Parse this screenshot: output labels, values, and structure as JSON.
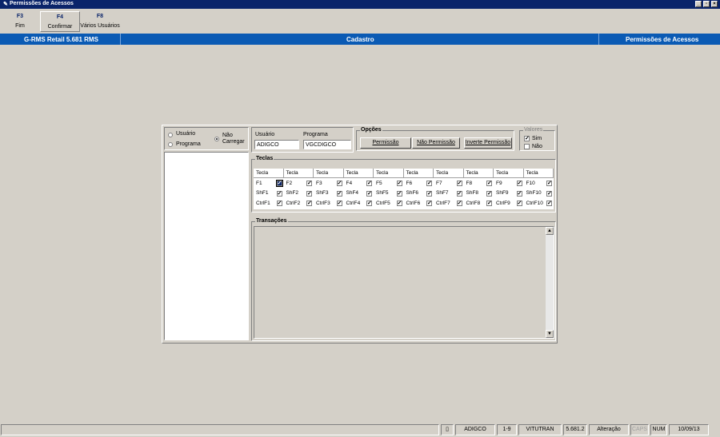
{
  "window": {
    "title": "Permissões de Acessos",
    "controls": [
      "_",
      "▫",
      "×"
    ]
  },
  "toolbar": [
    {
      "key": "F3",
      "label": "Fim"
    },
    {
      "key": "F4",
      "label": "Confirmar"
    },
    {
      "key": "F8",
      "label": "Vários Usuários"
    }
  ],
  "header": {
    "app": "G-RMS Retail 5.681 RMS",
    "section": "Cadastro",
    "screen": "Permissões de Acessos"
  },
  "left": {
    "radio_usuario": "Usuário",
    "radio_programa": "Programa",
    "radio_nao_carregar": "Não Carregar"
  },
  "fields": {
    "usuario_label": "Usuário",
    "usuario_value": "ADIGCO",
    "programa_label": "Programa",
    "programa_value": "VGCDIGCO"
  },
  "opcoes": {
    "title": "Opções",
    "permissao": "Permissão",
    "nao_permissao": "Não Permissão",
    "inverte_permissao": "Inverte Permissão"
  },
  "valores": {
    "title": "Valores",
    "sim": "Sim",
    "nao": "Não",
    "sim_checked": true,
    "nao_checked": false
  },
  "teclas": {
    "title": "Teclas",
    "header": "Tecla",
    "rows": [
      [
        "F1",
        "F2",
        "F3",
        "F4",
        "F5",
        "F6",
        "F7",
        "F8",
        "F9",
        "F10"
      ],
      [
        "ShF1",
        "ShF2",
        "ShF3",
        "ShF4",
        "ShF5",
        "ShF6",
        "ShF7",
        "ShF8",
        "ShF9",
        "ShF10"
      ],
      [
        "CtrlF1",
        "CtrlF2",
        "CtrlF3",
        "CtrlF4",
        "CtrlF5",
        "CtrlF6",
        "CtrlF7",
        "CtrlF8",
        "CtrlF9",
        "CtrlF10"
      ]
    ]
  },
  "transacoes": {
    "title": "Transações"
  },
  "status": {
    "user": "ADIGCO",
    "range": "1-9",
    "tran": "VITUTRAN",
    "version": "5.681.2",
    "mode": "Alteração",
    "caps": "CAPS",
    "num": "NUM",
    "date": "10/09/13"
  }
}
